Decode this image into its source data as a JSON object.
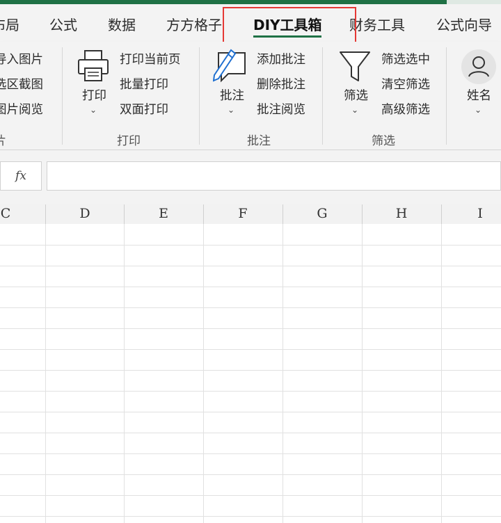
{
  "tabs": [
    {
      "label": "布局"
    },
    {
      "label": "公式"
    },
    {
      "label": "数据"
    },
    {
      "label": "方方格子"
    },
    {
      "label": "DIY工具箱",
      "active": true
    },
    {
      "label": "财务工具"
    },
    {
      "label": "公式向导"
    }
  ],
  "ribbon": {
    "image_group": {
      "items": [
        "导入图片",
        "选区截图",
        "图片阅览"
      ],
      "label": "片"
    },
    "print_group": {
      "big_button": "打印",
      "items": [
        "打印当前页",
        "批量打印",
        "双面打印"
      ],
      "label": "打印"
    },
    "comment_group": {
      "big_button": "批注",
      "items": [
        "添加批注",
        "删除批注",
        "批注阅览"
      ],
      "label": "批注"
    },
    "filter_group": {
      "big_button": "筛选",
      "items": [
        "筛选选中",
        "清空筛选",
        "高级筛选"
      ],
      "label": "筛选"
    },
    "name_group": {
      "big_button": "姓名"
    }
  },
  "formula_bar": {
    "fx_label": "fx",
    "value": ""
  },
  "columns": [
    "C",
    "D",
    "E",
    "F",
    "G",
    "H",
    "I"
  ],
  "colors": {
    "accent": "#1f7145",
    "highlight": "#e53935"
  },
  "icons": {
    "print": "printer-icon",
    "comment": "comment-pencil-icon",
    "filter": "funnel-icon",
    "name": "user-icon",
    "dropdown": "chevron-down-icon"
  }
}
